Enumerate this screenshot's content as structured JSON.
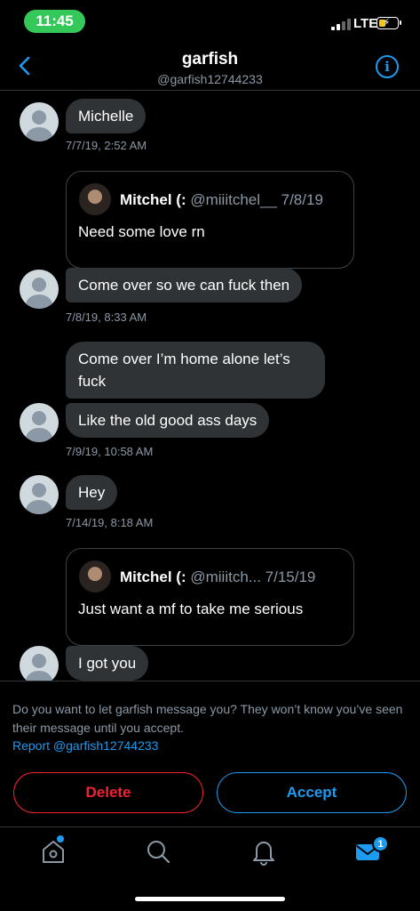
{
  "status_bar": {
    "time": "11:45",
    "network": "LTE"
  },
  "header": {
    "title": "garfish",
    "handle": "@garfish12744233"
  },
  "messages": {
    "m1": {
      "text": "Michelle",
      "time": "7/7/19, 2:52 AM"
    },
    "quote1": {
      "name": "Mitchel (:",
      "meta": "@miiitchel__ 7/8/19",
      "text": "Need some love rn"
    },
    "m2": {
      "text": "Come over so we can fuck then",
      "time": "7/8/19, 8:33 AM"
    },
    "m3": {
      "text": "Come over I’m home alone let’s fuck"
    },
    "m4": {
      "text": "Like the old good ass days",
      "time": "7/9/19, 10:58 AM"
    },
    "m5": {
      "text": "Hey",
      "time": "7/14/19, 8:18 AM"
    },
    "quote2": {
      "name": "Mitchel (:",
      "meta": "@miiitch...   7/15/19",
      "text": "Just want a mf to take me serious"
    },
    "m6": {
      "text": "I got you"
    }
  },
  "request": {
    "text": "Do you want to let garfish message you? They won’t know you’ve seen their message until you accept.",
    "report_label": "Report @garfish12744233",
    "delete_label": "Delete",
    "accept_label": "Accept"
  },
  "tabbar": {
    "messages_badge": "1"
  },
  "colors": {
    "accent": "#1d9bf0",
    "danger": "#f4212e",
    "bubble": "#2f3336",
    "muted": "#8b98a5",
    "status_green": "#34c759"
  },
  "icons": [
    "back-chevron-icon",
    "info-icon",
    "home-icon",
    "search-icon",
    "bell-icon",
    "mail-icon"
  ]
}
